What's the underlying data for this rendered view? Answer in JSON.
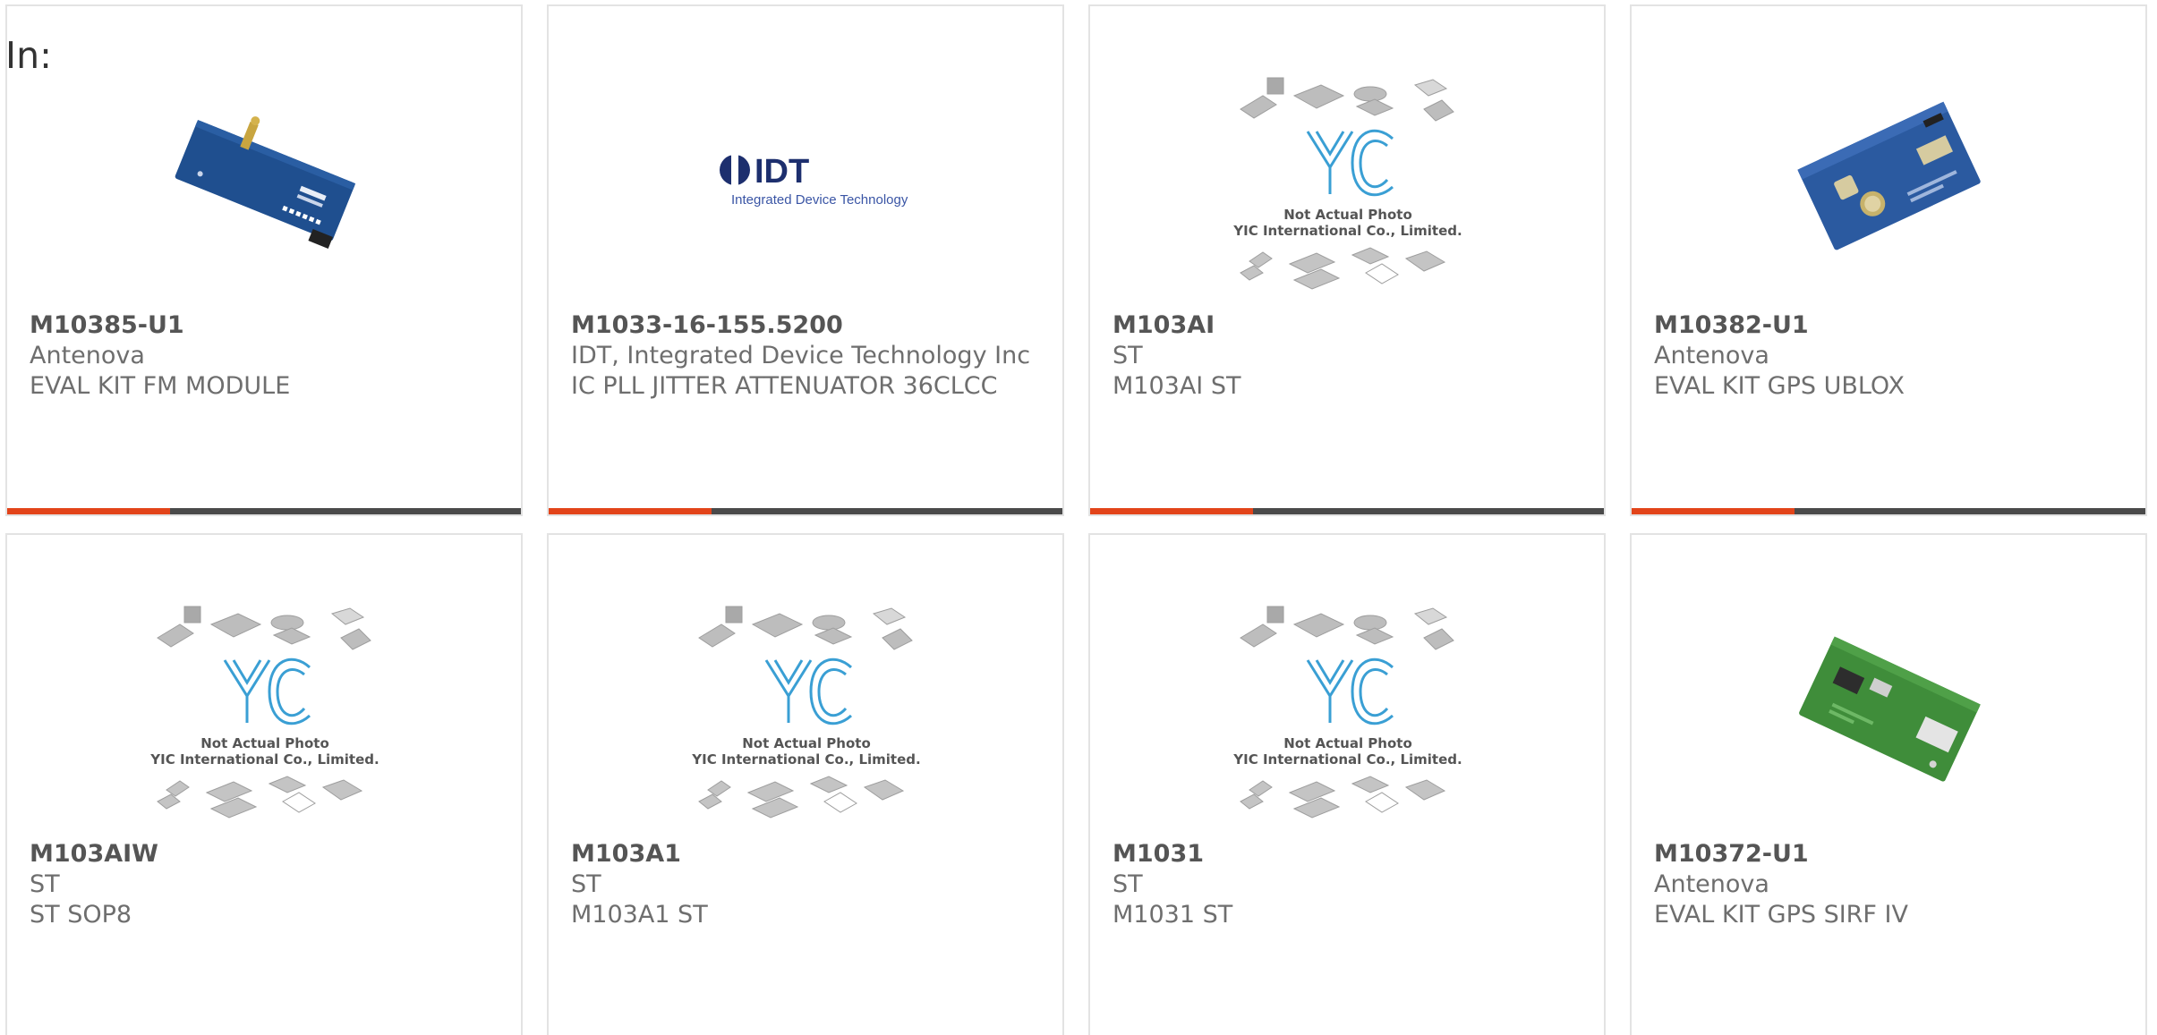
{
  "filter": {
    "label": "In:"
  },
  "colors": {
    "accent": "#e2441a",
    "bar": "#4a4a4a",
    "card_border": "#e3e3e3",
    "part_number": "#555555",
    "text": "#6e6e6e"
  },
  "products": [
    {
      "part_number": "M10385-U1",
      "manufacturer": "Antenova",
      "description": "EVAL KIT FM MODULE",
      "image": "blue-eval-board-fm"
    },
    {
      "part_number": "M1033-16-155.5200",
      "manufacturer": "IDT, Integrated Device Technology Inc",
      "description": "IC PLL JITTER ATTENUATOR 36CLCC",
      "image": "idt-logo",
      "image_text": {
        "brand": "IDT",
        "caption": "Integrated Device Technology"
      }
    },
    {
      "part_number": "M103AI",
      "manufacturer": "ST",
      "description": "M103AI ST",
      "image": "yic-placeholder",
      "image_text": {
        "logo": "YIC",
        "line1": "Not Actual Photo",
        "line2": "YIC International Co., Limited."
      }
    },
    {
      "part_number": "M10382-U1",
      "manufacturer": "Antenova",
      "description": "EVAL KIT GPS UBLOX",
      "image": "blue-eval-board-gps"
    },
    {
      "part_number": "M103AIW",
      "manufacturer": "ST",
      "description": "ST SOP8",
      "image": "yic-placeholder",
      "image_text": {
        "logo": "YIC",
        "line1": "Not Actual Photo",
        "line2": "YIC International Co., Limited."
      }
    },
    {
      "part_number": "M103A1",
      "manufacturer": "ST",
      "description": "M103A1 ST",
      "image": "yic-placeholder",
      "image_text": {
        "logo": "YIC",
        "line1": "Not Actual Photo",
        "line2": "YIC International Co., Limited."
      }
    },
    {
      "part_number": "M1031",
      "manufacturer": "ST",
      "description": "M1031 ST",
      "image": "yic-placeholder",
      "image_text": {
        "logo": "YIC",
        "line1": "Not Actual Photo",
        "line2": "YIC International Co., Limited."
      }
    },
    {
      "part_number": "M10372-U1",
      "manufacturer": "Antenova",
      "description": "EVAL KIT GPS SIRF IV",
      "image": "green-eval-board"
    }
  ]
}
